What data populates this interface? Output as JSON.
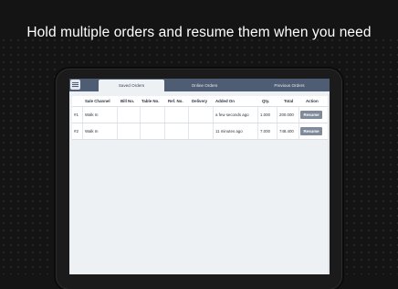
{
  "headline": "Hold multiple orders and resume them when you need",
  "tabs": [
    {
      "label": "Saved Orders",
      "active": true
    },
    {
      "label": "Online Orders",
      "active": false
    },
    {
      "label": "Previous Orders",
      "active": false
    }
  ],
  "table": {
    "columns": [
      "Sale Channel",
      "Bill No.",
      "Table No.",
      "Ref. No.",
      "Delivery",
      "Added On",
      "Qty.",
      "Total",
      "Action"
    ],
    "rows": [
      {
        "index": "#1",
        "sale_channel": "Walk In",
        "bill_no": "",
        "table_no": "",
        "ref_no": "",
        "delivery": "",
        "added_on": "a few seconds ago",
        "qty": "1.000",
        "total": "200.000",
        "action": "Resume"
      },
      {
        "index": "#2",
        "sale_channel": "Walk In",
        "bill_no": "",
        "table_no": "",
        "ref_no": "",
        "delivery": "",
        "added_on": "11 minutes ago",
        "qty": "7.000",
        "total": "748.400",
        "action": "Resume"
      }
    ]
  },
  "colors": {
    "background": "#141414",
    "topbar": "#4f5d74",
    "screen": "#eef1f3",
    "resume_button": "#7f8b9b"
  },
  "icons": {
    "menu": "hamburger-menu-icon"
  }
}
